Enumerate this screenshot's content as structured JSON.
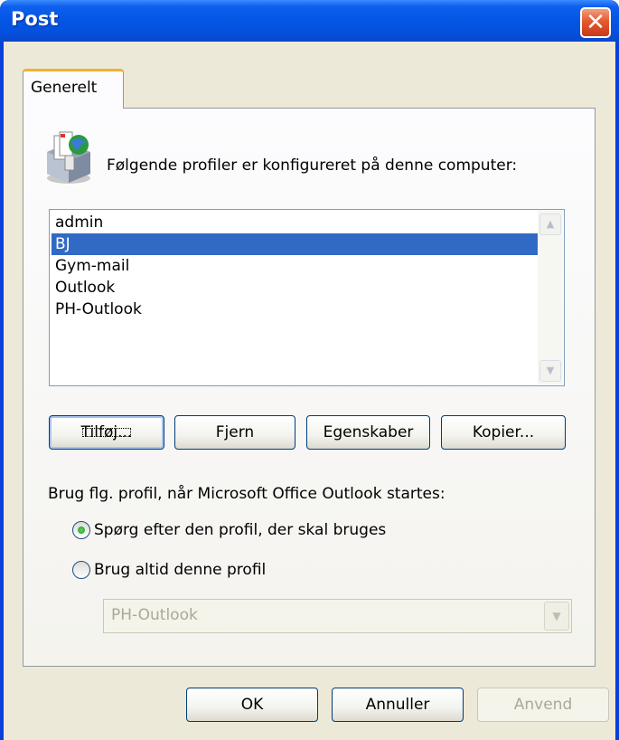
{
  "window": {
    "title": "Post",
    "close_glyph": "✕"
  },
  "tabs": [
    {
      "label": "Generelt"
    }
  ],
  "intro": {
    "icon": "mail-profiles-icon",
    "text": "Følgende profiler er konfigureret på denne computer:"
  },
  "profiles": {
    "items": [
      "admin",
      "BJ",
      "Gym-mail",
      "Outlook",
      "PH-Outlook"
    ],
    "selected": "BJ"
  },
  "buttons": {
    "add": "Tilføj...",
    "remove": "Fjern",
    "properties": "Egenskaber",
    "copy": "Kopier..."
  },
  "startup": {
    "prompt": "Brug flg. profil, når Microsoft Office Outlook startes:",
    "option_ask": "Spørg efter den profil, der skal bruges",
    "option_always": "Brug altid denne profil",
    "selected_option": "ask",
    "profile_value": "PH-Outlook"
  },
  "footer": {
    "ok": "OK",
    "cancel": "Annuller",
    "apply": "Anvend"
  },
  "colors": {
    "titlebar": "#0556e6",
    "selection": "#316ac5",
    "tab_highlight": "#f0b030",
    "face": "#ece9d8"
  }
}
